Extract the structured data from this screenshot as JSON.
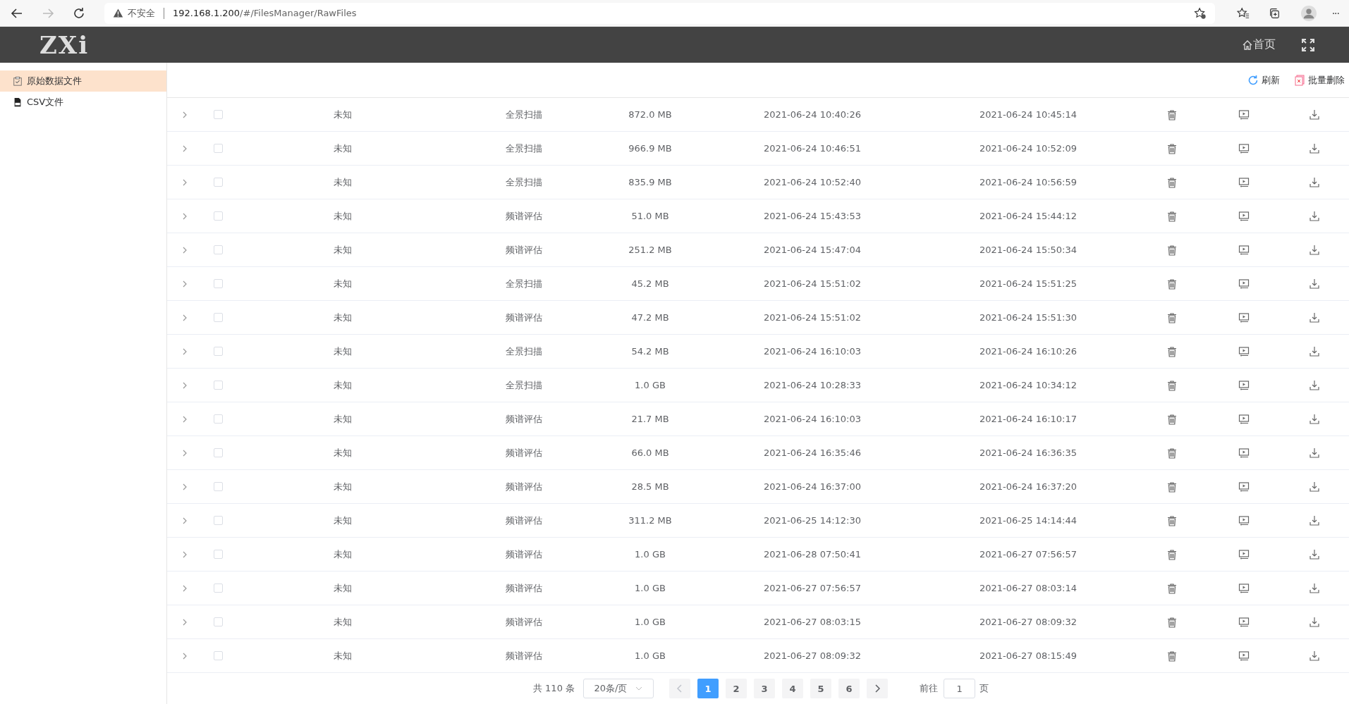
{
  "browser": {
    "security": "不安全",
    "host": "192.168.1.200",
    "path": "/#/FilesManager/RawFiles",
    "menu": "···"
  },
  "header": {
    "logo": "ZXi",
    "home": "首页"
  },
  "sidebar": {
    "items": [
      {
        "label": "原始数据文件",
        "selected": true,
        "kind": "clipboard"
      },
      {
        "label": "CSV文件",
        "selected": false,
        "kind": "csv"
      }
    ]
  },
  "toolbar": {
    "refresh": "刷新",
    "batch_delete": "批量删除"
  },
  "table": {
    "rows": [
      {
        "expanded": false,
        "checked": false,
        "name": "未知",
        "type": "全景扫描",
        "size": "872.0 MB",
        "start": "2021-06-24 10:40:26",
        "end": "2021-06-24 10:45:14"
      },
      {
        "expanded": false,
        "checked": false,
        "name": "未知",
        "type": "全景扫描",
        "size": "966.9 MB",
        "start": "2021-06-24 10:46:51",
        "end": "2021-06-24 10:52:09"
      },
      {
        "expanded": false,
        "checked": false,
        "name": "未知",
        "type": "全景扫描",
        "size": "835.9 MB",
        "start": "2021-06-24 10:52:40",
        "end": "2021-06-24 10:56:59"
      },
      {
        "expanded": false,
        "checked": false,
        "name": "未知",
        "type": "频谱评估",
        "size": "51.0 MB",
        "start": "2021-06-24 15:43:53",
        "end": "2021-06-24 15:44:12"
      },
      {
        "expanded": false,
        "checked": false,
        "name": "未知",
        "type": "频谱评估",
        "size": "251.2 MB",
        "start": "2021-06-24 15:47:04",
        "end": "2021-06-24 15:50:34"
      },
      {
        "expanded": false,
        "checked": false,
        "name": "未知",
        "type": "全景扫描",
        "size": "45.2 MB",
        "start": "2021-06-24 15:51:02",
        "end": "2021-06-24 15:51:25"
      },
      {
        "expanded": false,
        "checked": false,
        "name": "未知",
        "type": "频谱评估",
        "size": "47.2 MB",
        "start": "2021-06-24 15:51:02",
        "end": "2021-06-24 15:51:30"
      },
      {
        "expanded": false,
        "checked": false,
        "name": "未知",
        "type": "全景扫描",
        "size": "54.2 MB",
        "start": "2021-06-24 16:10:03",
        "end": "2021-06-24 16:10:26"
      },
      {
        "expanded": false,
        "checked": false,
        "name": "未知",
        "type": "全景扫描",
        "size": "1.0 GB",
        "start": "2021-06-24 10:28:33",
        "end": "2021-06-24 10:34:12"
      },
      {
        "expanded": false,
        "checked": false,
        "name": "未知",
        "type": "频谱评估",
        "size": "21.7 MB",
        "start": "2021-06-24 16:10:03",
        "end": "2021-06-24 16:10:17"
      },
      {
        "expanded": false,
        "checked": false,
        "name": "未知",
        "type": "频谱评估",
        "size": "66.0 MB",
        "start": "2021-06-24 16:35:46",
        "end": "2021-06-24 16:36:35"
      },
      {
        "expanded": false,
        "checked": false,
        "name": "未知",
        "type": "频谱评估",
        "size": "28.5 MB",
        "start": "2021-06-24 16:37:00",
        "end": "2021-06-24 16:37:20"
      },
      {
        "expanded": false,
        "checked": false,
        "name": "未知",
        "type": "频谱评估",
        "size": "311.2 MB",
        "start": "2021-06-25 14:12:30",
        "end": "2021-06-25 14:14:44"
      },
      {
        "expanded": false,
        "checked": false,
        "name": "未知",
        "type": "频谱评估",
        "size": "1.0 GB",
        "start": "2021-06-28 07:50:41",
        "end": "2021-06-27 07:56:57"
      },
      {
        "expanded": false,
        "checked": false,
        "name": "未知",
        "type": "频谱评估",
        "size": "1.0 GB",
        "start": "2021-06-27 07:56:57",
        "end": "2021-06-27 08:03:14"
      },
      {
        "expanded": false,
        "checked": false,
        "name": "未知",
        "type": "频谱评估",
        "size": "1.0 GB",
        "start": "2021-06-27 08:03:15",
        "end": "2021-06-27 08:09:32"
      },
      {
        "expanded": false,
        "checked": false,
        "name": "未知",
        "type": "频谱评估",
        "size": "1.0 GB",
        "start": "2021-06-27 08:09:32",
        "end": "2021-06-27 08:15:49"
      }
    ]
  },
  "pagination": {
    "total": "共 110 条",
    "page_size": "20条/页",
    "pages": [
      {
        "label": "1",
        "selected": true
      },
      {
        "label": "2",
        "selected": false
      },
      {
        "label": "3",
        "selected": false
      },
      {
        "label": "4",
        "selected": false
      },
      {
        "label": "5",
        "selected": false
      },
      {
        "label": "6",
        "selected": false
      }
    ],
    "goto_label": "前往",
    "goto_value": "1",
    "goto_suffix": "页"
  }
}
